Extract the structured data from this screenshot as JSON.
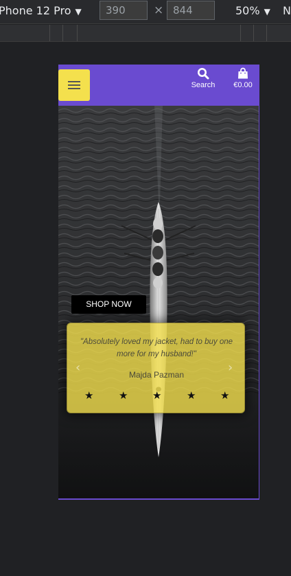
{
  "devtools": {
    "device_name": "Phone 12 Pro",
    "width_value": "390",
    "height_value": "844",
    "dimension_separator": "×",
    "zoom": "50%",
    "more": "N",
    "caret": "▼"
  },
  "header": {
    "search_label": "Search",
    "cart_total": "€0.00"
  },
  "hero": {
    "cta_label": "SHOP NOW"
  },
  "testimonial": {
    "quote": "\"Absolutely loved my jacket, had to buy one more for my husband!\"",
    "author": "Majda Pazman",
    "rating": 5,
    "star_glyph": "★",
    "prev_glyph": "‹",
    "next_glyph": "›"
  },
  "colors": {
    "header_bg": "#6a4bd0",
    "menu_button_bg": "#f4e04d",
    "testimonial_bg": "#f4e04d",
    "devtools_bg": "#202124"
  },
  "icons": [
    "search-icon",
    "shopping-bag-icon",
    "hamburger-icon",
    "star-icon",
    "chevron-left-icon",
    "chevron-right-icon"
  ]
}
